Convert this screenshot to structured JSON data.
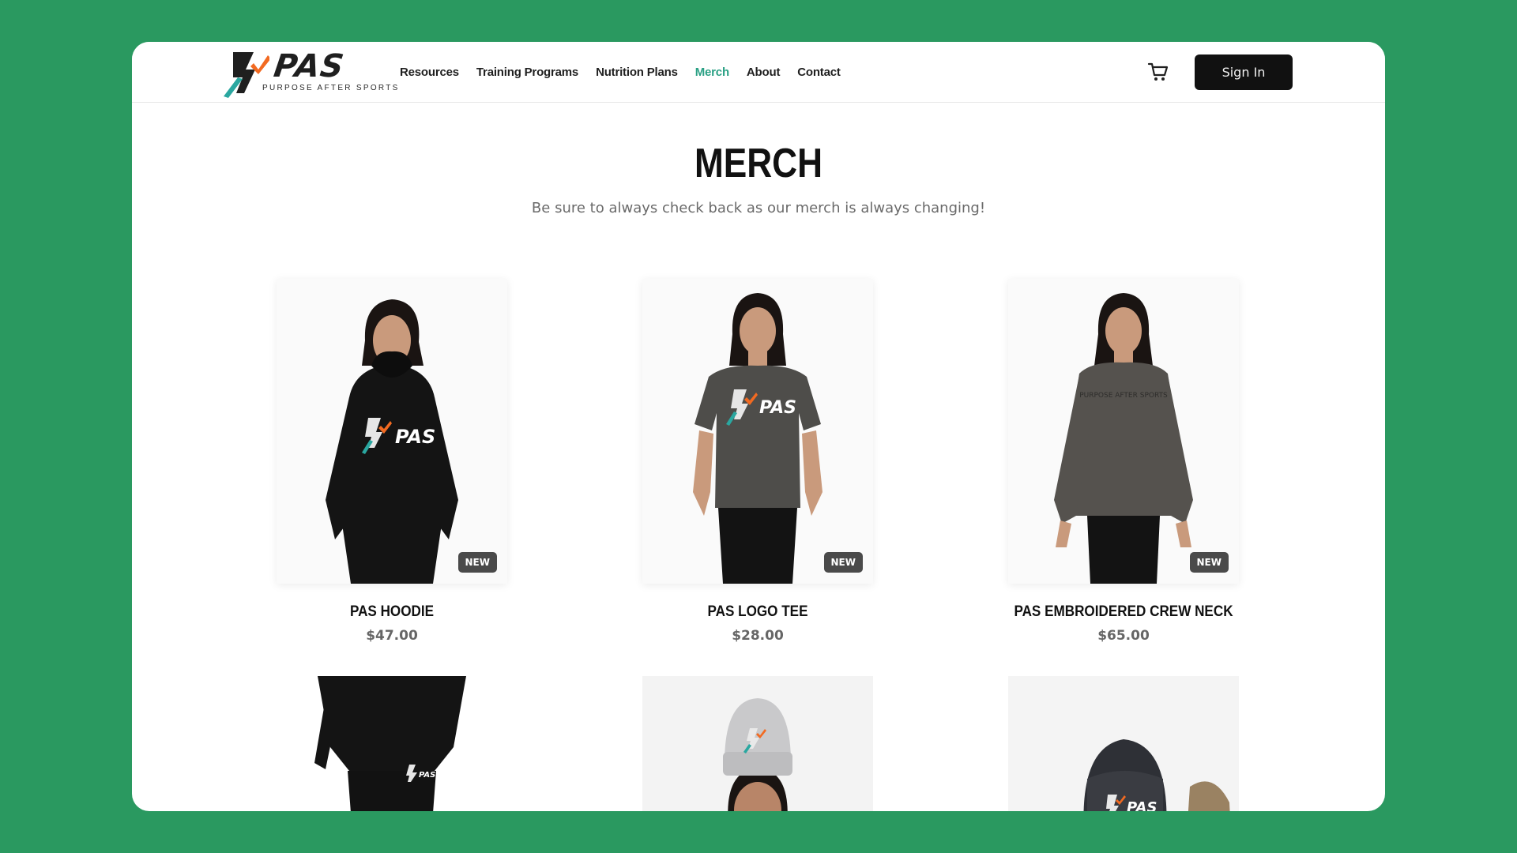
{
  "brand": {
    "wordmark": "PAS",
    "tagline": "PURPOSE AFTER SPORTS",
    "colors": {
      "teal": "#2aa7a0",
      "orange": "#f26a21",
      "dark": "#1f1f1f"
    }
  },
  "nav": {
    "links": [
      {
        "label": "Resources"
      },
      {
        "label": "Training Programs"
      },
      {
        "label": "Nutrition Plans"
      },
      {
        "label": "Merch",
        "active": true
      },
      {
        "label": "About"
      },
      {
        "label": "Contact"
      }
    ],
    "cart_icon": "cart-icon",
    "signin_label": "Sign In"
  },
  "page": {
    "title": "MERCH",
    "subtitle": "Be sure to always check back as our merch is always changing!"
  },
  "products": [
    {
      "name": "PAS HOODIE",
      "price": "$47.00",
      "badge": "NEW",
      "garment_color": "#141414"
    },
    {
      "name": "PAS LOGO TEE",
      "price": "$28.00",
      "badge": "NEW",
      "garment_color": "#4e4d4a"
    },
    {
      "name": "PAS EMBROIDERED CREW NECK",
      "price": "$65.00",
      "badge": "NEW",
      "garment_color": "#55524e"
    }
  ],
  "products_row2": [
    {
      "kind": "sweatpants",
      "garment_color": "#141414"
    },
    {
      "kind": "beanie",
      "garment_color": "#c9c9cb"
    },
    {
      "kind": "cap",
      "garment_color": "#2e3036"
    }
  ],
  "colors": {
    "background": "#2a9960",
    "accent": "#2aa084",
    "button": "#111111"
  }
}
